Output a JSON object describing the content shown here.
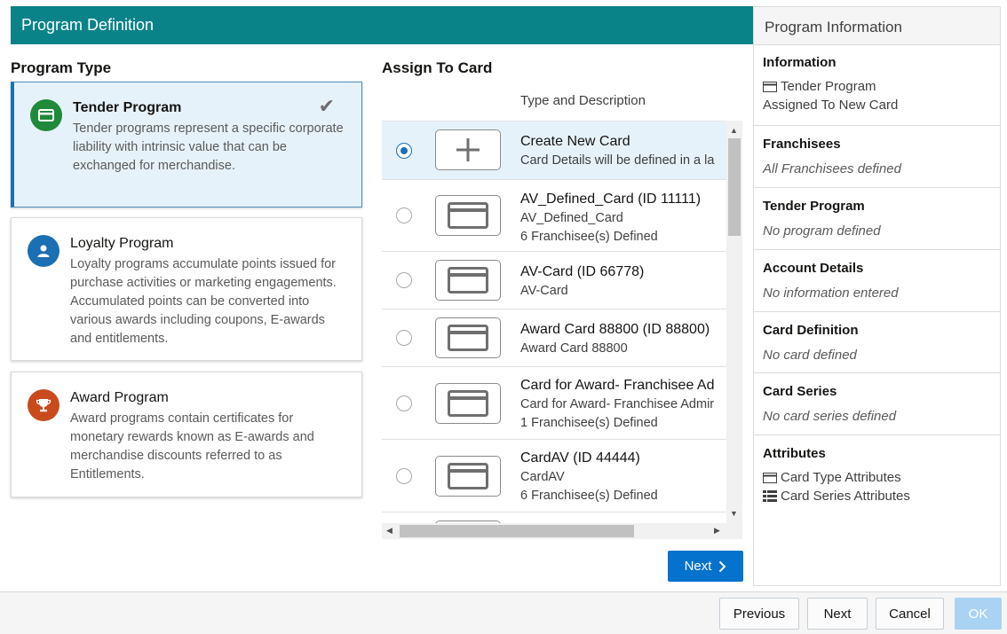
{
  "header": {
    "title": "Program Definition"
  },
  "program_type": {
    "heading": "Program Type",
    "items": [
      {
        "title": "Tender Program",
        "description": "Tender programs represent a specific corporate liability with intrinsic value that can be exchanged for merchandise.",
        "icon": "card-icon",
        "color": "#1e8a3a",
        "selected": true
      },
      {
        "title": "Loyalty Program",
        "description": "Loyalty programs accumulate points issued for purchase activities or marketing engagements. Accumulated points can be converted into various awards including coupons, E-awards and entitlements.",
        "icon": "person-icon",
        "color": "#1b6fb3",
        "selected": false
      },
      {
        "title": "Award Program",
        "description": "Award programs contain certificates for monetary rewards known as E-awards and merchandise discounts referred to as Entitlements.",
        "icon": "trophy-icon",
        "color": "#c94a1d",
        "selected": false
      }
    ]
  },
  "assign": {
    "heading": "Assign To Card",
    "column_header": "Type and Description",
    "rows": [
      {
        "title": "Create New Card",
        "lines": [
          "Card Details will be defined in a la"
        ],
        "type": "new",
        "selected": true
      },
      {
        "title": "AV_Defined_Card (ID 11111)",
        "lines": [
          "AV_Defined_Card",
          "6 Franchisee(s) Defined"
        ],
        "type": "card",
        "selected": false
      },
      {
        "title": "AV-Card (ID 66778)",
        "lines": [
          "AV-Card"
        ],
        "type": "card",
        "selected": false
      },
      {
        "title": "Award Card 88800 (ID 88800)",
        "lines": [
          "Award Card 88800"
        ],
        "type": "card",
        "selected": false
      },
      {
        "title": "Card for Award- Franchisee Ad",
        "lines": [
          "Card for Award- Franchisee Admir",
          "1 Franchisee(s) Defined"
        ],
        "type": "card",
        "selected": false
      },
      {
        "title": "CardAV (ID 44444)",
        "lines": [
          "CardAV",
          "6 Franchisee(s) Defined"
        ],
        "type": "card",
        "selected": false
      },
      {
        "title": "",
        "lines": [],
        "type": "card",
        "selected": false
      }
    ],
    "next_label": "Next"
  },
  "info_panel": {
    "title": "Program Information",
    "sections": [
      {
        "title": "Information",
        "lines": [
          {
            "text": "Tender Program",
            "icon": "card-icon"
          },
          {
            "text": "Assigned To New Card"
          }
        ],
        "italic": false
      },
      {
        "title": "Franchisees",
        "lines": [
          {
            "text": "All Franchisees defined"
          }
        ],
        "italic": true
      },
      {
        "title": "Tender Program",
        "lines": [
          {
            "text": "No program defined"
          }
        ],
        "italic": true
      },
      {
        "title": "Account Details",
        "lines": [
          {
            "text": "No information entered"
          }
        ],
        "italic": true
      },
      {
        "title": "Card Definition",
        "lines": [
          {
            "text": "No card defined"
          }
        ],
        "italic": true
      },
      {
        "title": "Card Series",
        "lines": [
          {
            "text": "No card series defined"
          }
        ],
        "italic": true
      },
      {
        "title": "Attributes",
        "lines": [
          {
            "text": "Card Type Attributes",
            "icon": "card-icon"
          },
          {
            "text": "Card Series Attributes",
            "icon": "list-icon"
          }
        ],
        "italic": false
      }
    ]
  },
  "footer": {
    "previous": "Previous",
    "next": "Next",
    "cancel": "Cancel",
    "ok": "OK"
  }
}
